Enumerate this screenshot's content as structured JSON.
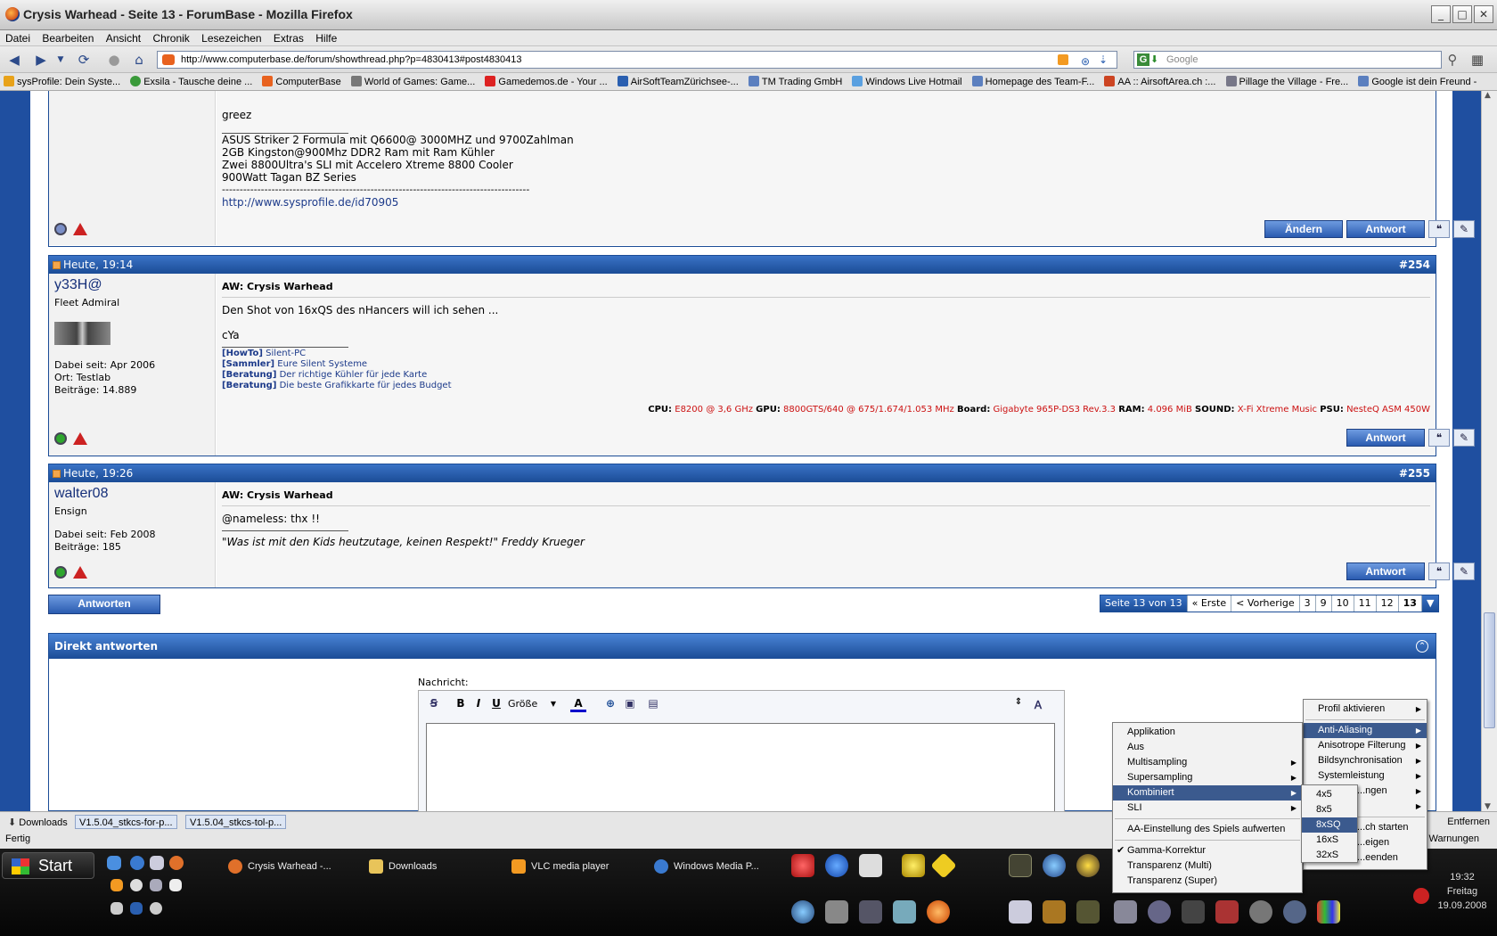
{
  "window": {
    "title": "Crysis Warhead - Seite 13 - ForumBase - Mozilla Firefox"
  },
  "menubar": [
    "Datei",
    "Bearbeiten",
    "Ansicht",
    "Chronik",
    "Lesezeichen",
    "Extras",
    "Hilfe"
  ],
  "urlbar": {
    "url": "http://www.computerbase.de/forum/showthread.php?p=4830413#post4830413"
  },
  "search": {
    "placeholder": "Google"
  },
  "bookmarks": [
    "sysProfile: Dein Syste...",
    "Exsila - Tausche deine ...",
    "ComputerBase",
    "World of Games: Game...",
    "Gamedemos.de - Your ...",
    "AirSoftTeamZürichsee-...",
    "TM Trading GmbH",
    "Windows Live Hotmail",
    "Homepage des Team-F...",
    "AA :: AirsoftArea.ch :...",
    "Pillage the Village - Fre...",
    "Google ist dein Freund -"
  ],
  "post_prev": {
    "lines": [
      "greez",
      "ASUS Striker 2 Formula mit Q6600@ 3000MHZ und 9700Zahlman",
      "2GB Kingston@900Mhz DDR2 Ram mit Ram Kühler",
      "Zwei 8800Ultra's SLI mit Accelero Xtreme 8800 Cooler",
      "900Watt Tagan BZ Series",
      "---------------------------------------------------------------------------------------",
      "http://www.sysprofile.de/id70905"
    ],
    "edit_label": "Ändern",
    "reply_label": "Antwort"
  },
  "post_254": {
    "date": "Heute, 19:14",
    "number": "#254",
    "user": "y33H@",
    "rank": "Fleet Admiral",
    "joined": "Dabei seit: Apr 2006",
    "location": "Ort: Testlab",
    "posts": "Beiträge: 14.889",
    "title": "AW: Crysis Warhead",
    "body": "Den Shot von 16xQS des nHancers will ich sehen ...",
    "body2": "cYa",
    "sig": [
      {
        "tag": "[HowTo]",
        "text": "Silent-PC"
      },
      {
        "tag": "[Sammler]",
        "text": "Eure Silent Systeme"
      },
      {
        "tag": "[Beratung]",
        "text": "Der richtige Kühler für jede Karte"
      },
      {
        "tag": "[Beratung]",
        "text": "Die beste Grafikkarte für jedes Budget"
      }
    ],
    "specs": {
      "cpu_label": "CPU:",
      "cpu": "E8200 @ 3,6 GHz",
      "gpu_label": "GPU:",
      "gpu": "8800GTS/640 @ 675/1.674/1.053 MHz",
      "board_label": "Board:",
      "board": "Gigabyte 965P-DS3 Rev.3.3",
      "ram_label": "RAM:",
      "ram": "4.096 MiB",
      "sound_label": "SOUND:",
      "sound": "X-Fi Xtreme Music",
      "psu_label": "PSU:",
      "psu": "NesteQ ASM 450W"
    },
    "reply_label": "Antwort"
  },
  "post_255": {
    "date": "Heute, 19:26",
    "number": "#255",
    "user": "walter08",
    "rank": "Ensign",
    "joined": "Dabei seit: Feb 2008",
    "posts": "Beiträge: 185",
    "title": "AW: Crysis Warhead",
    "body": "@nameless: thx !!",
    "quote": "\"Was ist mit den Kids heutzutage, keinen Respekt!\" Freddy Krueger",
    "reply_label": "Antwort"
  },
  "reply_button": "Antworten",
  "pager": [
    "Seite 13 von 13",
    "« Erste",
    "< Vorherige",
    "3",
    "9",
    "10",
    "11",
    "12",
    "13"
  ],
  "quick_reply": {
    "title": "Direkt antworten",
    "message_label": "Nachricht:",
    "size_label": "Größe"
  },
  "statusbar": {
    "status": "Fertig",
    "downloads_label": "Downloads",
    "dl1": "V1.5.04_stkcs-for-p...",
    "dl2": "V1.5.04_stkcs-tol-p...",
    "right1": "Entfernen",
    "right2": "Warnungen"
  },
  "taskbar": {
    "start": "Start",
    "tasks": [
      "Crysis Warhead -...",
      "Downloads",
      "VLC media player",
      "Windows Media P..."
    ],
    "time": "19:32",
    "day": "Freitag",
    "date": "19.09.2008"
  },
  "menu_main": {
    "items": [
      "Profil aktivieren",
      "Anti-Aliasing",
      "Anisotrope Filterung",
      "Bildsynchronisation",
      "Systemleistung",
      "...ngen",
      "...ch starten",
      "...eigen",
      "...eenden"
    ]
  },
  "menu_aa": {
    "items": [
      "Applikation",
      "Aus",
      "Multisampling",
      "Supersampling",
      "Kombiniert",
      "SLI",
      "AA-Einstellung des Spiels aufwerten",
      "Gamma-Korrektur",
      "Transparenz (Multi)",
      "Transparenz (Super)"
    ]
  },
  "menu_comb": {
    "items": [
      "4x5",
      "8x5",
      "8xSQ",
      "16xS",
      "32xS"
    ]
  }
}
